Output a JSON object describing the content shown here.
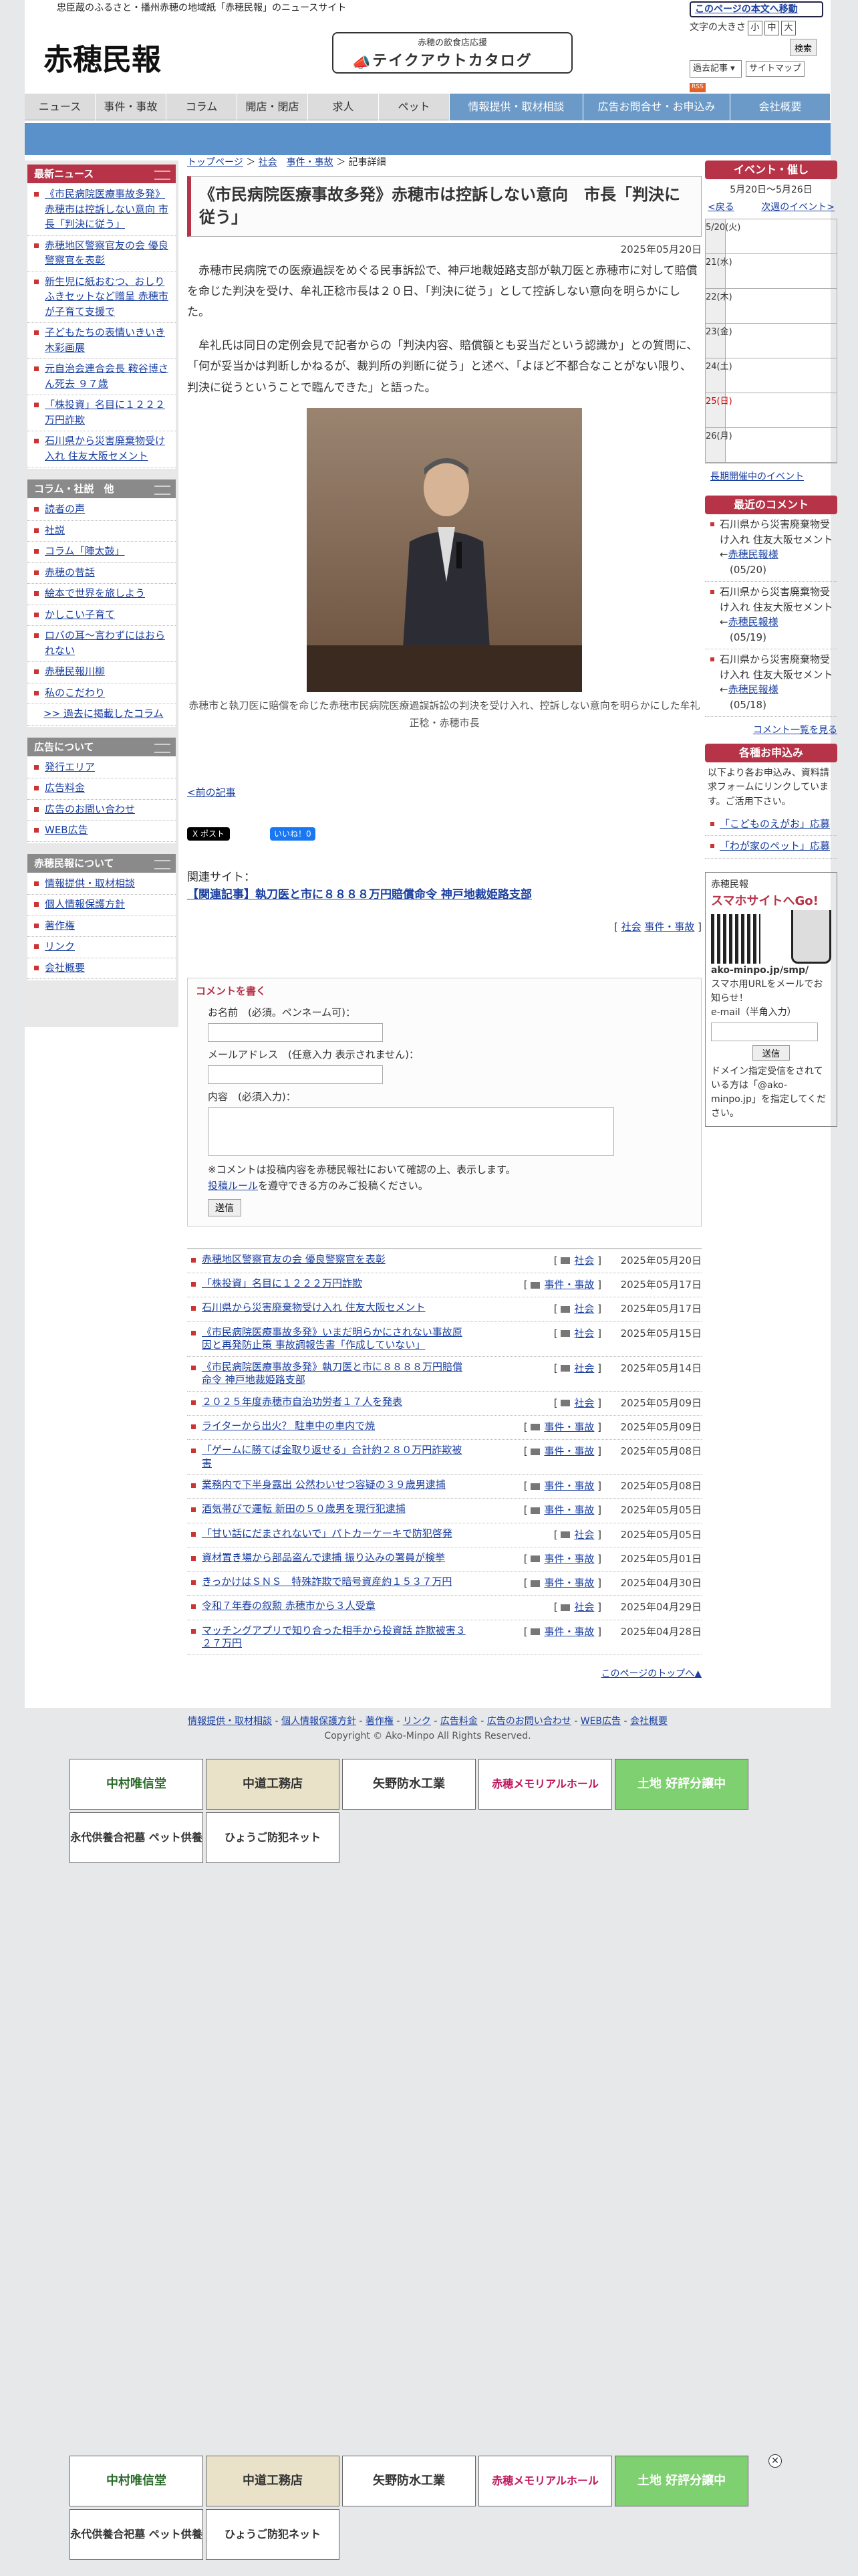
{
  "header": {
    "tagline": "忠臣蔵のふるさと・播州赤穂の地域紙「赤穂民報」のニュースサイト",
    "logo": "赤穂民報",
    "takeout_small": "赤穂の飲食店応援",
    "takeout_big": "テイクアウトカタログ",
    "skip": "このページの本文へ移動",
    "font_size": "文字の大きさ",
    "fs_s": "小",
    "fs_m": "中",
    "fs_l": "大",
    "search": "検索",
    "past": "過去記事",
    "sitemap": "サイトマップ",
    "rss": "RSS"
  },
  "nav": [
    "ニュース",
    "事件・事故",
    "コラム",
    "開店・閉店",
    "求人",
    "ペット",
    "情報提供・取材相談",
    "広告お問合せ・お申込み",
    "会社概要"
  ],
  "left": {
    "news_h": "最新ニュース",
    "news": [
      "《市民病院医療事故多発》赤穂市は控訴しない意向 市長「判決に従う」",
      "赤穂地区警察官友の会 優良警察官を表彰",
      "新生児に紙おむつ、おしりふきセットなど贈呈 赤穂市が子育て支援で",
      "子どもたちの表情いきいき 木彩画展",
      "元自治会連合会長 鞍谷博さん死去 ９７歳",
      "「株投資」名目に１２２２万円詐欺",
      "石川県から災害廃棄物受け入れ 住友大阪セメント"
    ],
    "col_h": "コラム・社説　他",
    "cols": [
      "読者の声",
      "社説",
      "コラム「陣太鼓」",
      "赤穂の昔話",
      "絵本で世界を旅しよう",
      "かしこい子育て",
      "ロバの耳〜言わずにはおられない",
      "赤穂民報川柳",
      "私のこだわり"
    ],
    "col_past": ">> 過去に掲載したコラム",
    "ad_h": "広告について",
    "ads": [
      "発行エリア",
      "広告料金",
      "広告のお問い合わせ",
      "WEB広告"
    ],
    "about_h": "赤穂民報について",
    "about": [
      "情報提供・取材相談",
      "個人情報保護方針",
      "著作権",
      "リンク",
      "会社概要"
    ]
  },
  "main": {
    "crumb_top": "トップページ",
    "crumb_cat": "社会",
    "crumb_cat2": "事件・事故",
    "crumb_here": "記事詳細",
    "title": "《市民病院医療事故多発》赤穂市は控訴しない意向　市長「判決に従う」",
    "date": "2025年05月20日",
    "p1": "赤穂市民病院での医療過誤をめぐる民事訴訟で、神戸地裁姫路支部が執刀医と赤穂市に対して賠償を命じた判決を受け、牟礼正稔市長は２０日、「判決に従う」として控訴しない意向を明らかにした。",
    "p2": "牟礼氏は同日の定例会見で記者からの「判決内容、賠償額とも妥当だという認識か」との質問に、「何が妥当かは判断しかねるが、裁判所の判断に従う」と述べ、「よほど不都合なことがない限り、判決に従うということで臨んできた」と語った。",
    "caption": "赤穂市と執刀医に賠償を命じた赤穂市民病院医療過誤訴訟の判決を受け入れ、控訴しない意向を明らかにした牟礼正稔・赤穂市長",
    "prev": "<前の記事",
    "x": "X ポスト",
    "fb": "いいね！0",
    "rel_label": "関連サイト：",
    "rel_link": "【関連記事】執刀医と市に８８８８万円賠償命令 神戸地裁姫路支部",
    "cat1": "社会",
    "cat2": "事件・事故"
  },
  "comment": {
    "head": "コメントを書く",
    "name": "お名前　(必須。ペンネーム可)：",
    "mail": "メールアドレス　(任意入力 表示されません)：",
    "body": "内容　(必須入力)：",
    "note1": "※コメントは投稿内容を赤穂民報社において確認の上、表示します。",
    "note2a": "投稿ルール",
    "note2b": "を遵守できる方のみご投稿ください。",
    "submit": "送信"
  },
  "list": [
    {
      "t": "赤穂地区警察官友の会 優良警察官を表彰",
      "c": "社会",
      "d": "2025年05月20日"
    },
    {
      "t": "「株投資」名目に１２２２万円詐欺",
      "c": "事件・事故",
      "d": "2025年05月17日"
    },
    {
      "t": "石川県から災害廃棄物受け入れ 住友大阪セメント",
      "c": "社会",
      "d": "2025年05月17日"
    },
    {
      "t": "《市民病院医療事故多発》いまだ明らかにされない事故原因と再発防止策 事故調報告書「作成していない」",
      "c": "社会",
      "d": "2025年05月15日"
    },
    {
      "t": "《市民病院医療事故多発》執刀医と市に８８８８万円賠償命令 神戸地裁姫路支部",
      "c": "社会",
      "d": "2025年05月14日"
    },
    {
      "t": "２０２５年度赤穂市自治功労者１７人を発表",
      "c": "社会",
      "d": "2025年05月09日"
    },
    {
      "t": "ライターから出火？ 駐車中の車内で焼",
      "c": "事件・事故",
      "d": "2025年05月09日"
    },
    {
      "t": "「ゲームに勝てば金取り返せる」合計約２８０万円詐欺被害",
      "c": "事件・事故",
      "d": "2025年05月08日"
    },
    {
      "t": "業務内で下半身露出 公然わいせつ容疑の３９歳男逮捕",
      "c": "事件・事故",
      "d": "2025年05月08日"
    },
    {
      "t": "酒気帯びで運転 新田の５０歳男を現行犯逮捕",
      "c": "事件・事故",
      "d": "2025年05月05日"
    },
    {
      "t": "「甘い話にだまされないで」パトカーケーキで防犯啓発",
      "c": "社会",
      "d": "2025年05月05日"
    },
    {
      "t": "資材置き場から部品盗んで逮捕 振り込みの署員が検挙",
      "c": "事件・事故",
      "d": "2025年05月01日"
    },
    {
      "t": "きっかけはＳＮＳ　特殊詐欺で暗号資産約１５３７万円",
      "c": "事件・事故",
      "d": "2025年04月30日"
    },
    {
      "t": "令和７年春の叙勲 赤穂市から３人受章",
      "c": "社会",
      "d": "2025年04月29日"
    },
    {
      "t": "マッチングアプリで知り合った相手から投資話 詐欺被害３２７万円",
      "c": "事件・事故",
      "d": "2025年04月28日"
    }
  ],
  "pagetop": "このページのトップへ▲",
  "right": {
    "ev_h": "イベント・催し",
    "ev_range": "5月20日〜5月26日",
    "back": "<戻る",
    "next": "次週のイベント>",
    "days": [
      "5/20(火)",
      "21(水)",
      "22(木)",
      "23(金)",
      "24(土)",
      "25(日)",
      "26(月)"
    ],
    "long": "長期開催中のイベント",
    "cm_h": "最近のコメント",
    "comments": [
      {
        "t": "石川県から災害廃棄物受け入れ 住友大阪セメント",
        "by": "赤穂民報様",
        "d": "(05/20)"
      },
      {
        "t": "石川県から災害廃棄物受け入れ 住友大阪セメント",
        "by": "赤穂民報様",
        "d": "(05/19)"
      },
      {
        "t": "石川県から災害廃棄物受け入れ 住友大阪セメント",
        "by": "赤穂民報様",
        "d": "(05/18)"
      }
    ],
    "cm_all": "コメント一覧を見る",
    "form_h": "各種お申込み",
    "form_txt": "以下より各お申込み、資料請求フォームにリンクしています。ご活用下さい。",
    "forms": [
      "「こどものえがお」応募",
      "「わが家のペット」応募"
    ],
    "sm_brand": "赤穂民報",
    "sm_big": "スマホサイトへGo!",
    "sm_url": "ako-minpo.jp/smp/",
    "sm_txt": "スマホ用URLをメールでお知らせ！",
    "sm_mail": "e-mail（半角入力）",
    "sm_send": "送信",
    "sm_note": "ドメイン指定受信をされている方は「@ako-minpo.jp」を指定してください。"
  },
  "footer": {
    "links": [
      "情報提供・取材相談",
      "個人情報保護方針",
      "著作権",
      "リンク",
      "広告料金",
      "広告のお問い合わせ",
      "WEB広告",
      "会社概要"
    ],
    "copy": "Copyright © Ako-Minpo All Rights Reserved."
  },
  "ads": [
    "中村唯信堂",
    "中道工務店",
    "矢野防水工業",
    "赤穂メモリアルホール",
    "土地 好評分譲中",
    "永代供養合祀墓 ペット供養",
    "ひょうご防犯ネット"
  ],
  "colors": {
    "accent": "#b73348",
    "nav_blue": "#6b9ac8"
  }
}
